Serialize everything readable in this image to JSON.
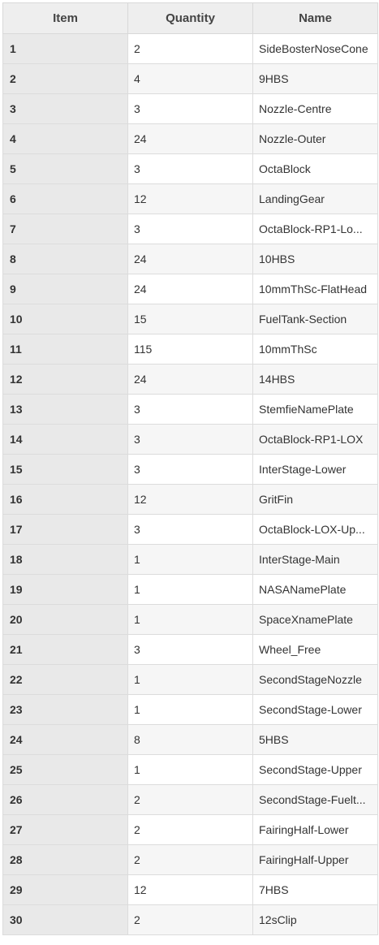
{
  "table": {
    "headers": {
      "item": "Item",
      "quantity": "Quantity",
      "name": "Name"
    },
    "rows": [
      {
        "item": "1",
        "quantity": "2",
        "name": "SideBosterNoseCone"
      },
      {
        "item": "2",
        "quantity": "4",
        "name": "9HBS"
      },
      {
        "item": "3",
        "quantity": "3",
        "name": "Nozzle-Centre"
      },
      {
        "item": "4",
        "quantity": "24",
        "name": "Nozzle-Outer"
      },
      {
        "item": "5",
        "quantity": "3",
        "name": "OctaBlock"
      },
      {
        "item": "6",
        "quantity": "12",
        "name": "LandingGear"
      },
      {
        "item": "7",
        "quantity": "3",
        "name": "OctaBlock-RP1-Lo..."
      },
      {
        "item": "8",
        "quantity": "24",
        "name": "10HBS"
      },
      {
        "item": "9",
        "quantity": "24",
        "name": "10mmThSc-FlatHead"
      },
      {
        "item": "10",
        "quantity": "15",
        "name": "FuelTank-Section"
      },
      {
        "item": "11",
        "quantity": "115",
        "name": "10mmThSc"
      },
      {
        "item": "12",
        "quantity": "24",
        "name": "14HBS"
      },
      {
        "item": "13",
        "quantity": "3",
        "name": "StemfieNamePlate"
      },
      {
        "item": "14",
        "quantity": "3",
        "name": "OctaBlock-RP1-LOX"
      },
      {
        "item": "15",
        "quantity": "3",
        "name": "InterStage-Lower"
      },
      {
        "item": "16",
        "quantity": "12",
        "name": "GritFin"
      },
      {
        "item": "17",
        "quantity": "3",
        "name": "OctaBlock-LOX-Up..."
      },
      {
        "item": "18",
        "quantity": "1",
        "name": "InterStage-Main"
      },
      {
        "item": "19",
        "quantity": "1",
        "name": "NASANamePlate"
      },
      {
        "item": "20",
        "quantity": "1",
        "name": "SpaceXnamePlate"
      },
      {
        "item": "21",
        "quantity": "3",
        "name": "Wheel_Free"
      },
      {
        "item": "22",
        "quantity": "1",
        "name": "SecondStageNozzle"
      },
      {
        "item": "23",
        "quantity": "1",
        "name": "SecondStage-Lower"
      },
      {
        "item": "24",
        "quantity": "8",
        "name": "5HBS"
      },
      {
        "item": "25",
        "quantity": "1",
        "name": "SecondStage-Upper"
      },
      {
        "item": "26",
        "quantity": "2",
        "name": "SecondStage-Fuelt..."
      },
      {
        "item": "27",
        "quantity": "2",
        "name": "FairingHalf-Lower"
      },
      {
        "item": "28",
        "quantity": "2",
        "name": "FairingHalf-Upper"
      },
      {
        "item": "29",
        "quantity": "12",
        "name": "7HBS"
      },
      {
        "item": "30",
        "quantity": "2",
        "name": "12sClip"
      }
    ]
  }
}
